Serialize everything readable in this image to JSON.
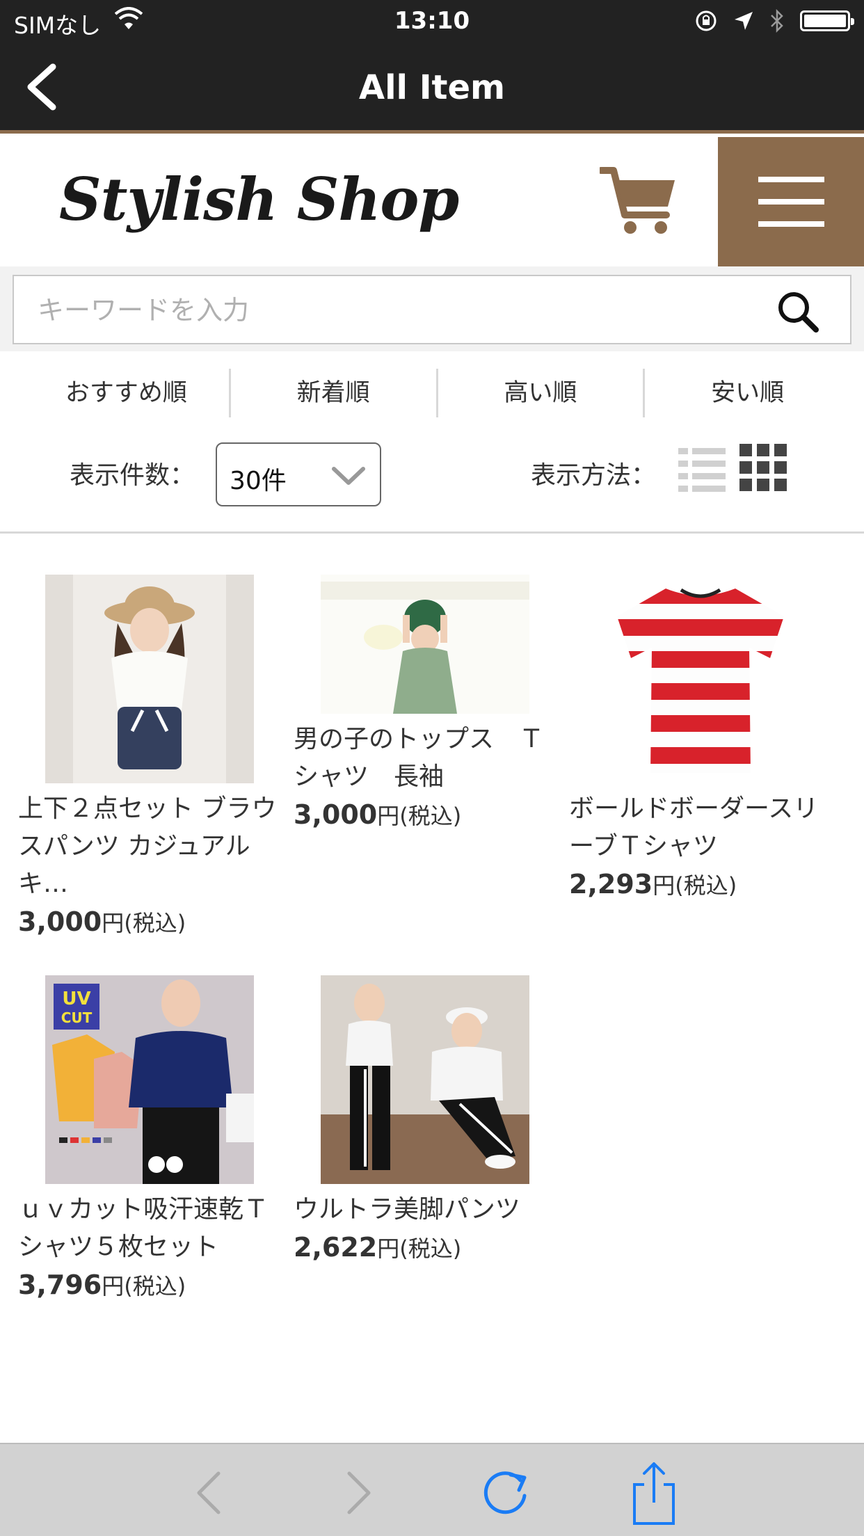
{
  "status_bar": {
    "carrier": "SIMなし",
    "time": "13:10"
  },
  "nav": {
    "title": "All Item"
  },
  "shop": {
    "logo": "Stylish Shop",
    "brand_color": "#8b6b4c"
  },
  "search": {
    "placeholder": "キーワードを入力",
    "value": ""
  },
  "sort_tabs": [
    "おすすめ順",
    "新着順",
    "高い順",
    "安い順"
  ],
  "display_count": {
    "label": "表示件数：",
    "selected": "30件"
  },
  "display_method": {
    "label": "表示方法：",
    "active": "grid"
  },
  "products": [
    {
      "name": "上下２点セット ブラウスパンツ カジュアル キ…",
      "price": "3,000",
      "unit": "円(税込)"
    },
    {
      "name": "男の子のトップス　Ｔシャツ　長袖",
      "price": "3,000",
      "unit": "円(税込)"
    },
    {
      "name": "ボールドボーダースリーブＴシャツ",
      "price": "2,293",
      "unit": "円(税込)"
    },
    {
      "name": "ｕｖカット吸汗速乾Ｔシャツ５枚セット",
      "price": "3,796",
      "unit": "円(税込)"
    },
    {
      "name": "ウルトラ美脚パンツ",
      "price": "2,622",
      "unit": "円(税込)"
    }
  ],
  "image_text": {
    "uv_badge_line1": "UV",
    "uv_badge_line2": "CUT"
  }
}
